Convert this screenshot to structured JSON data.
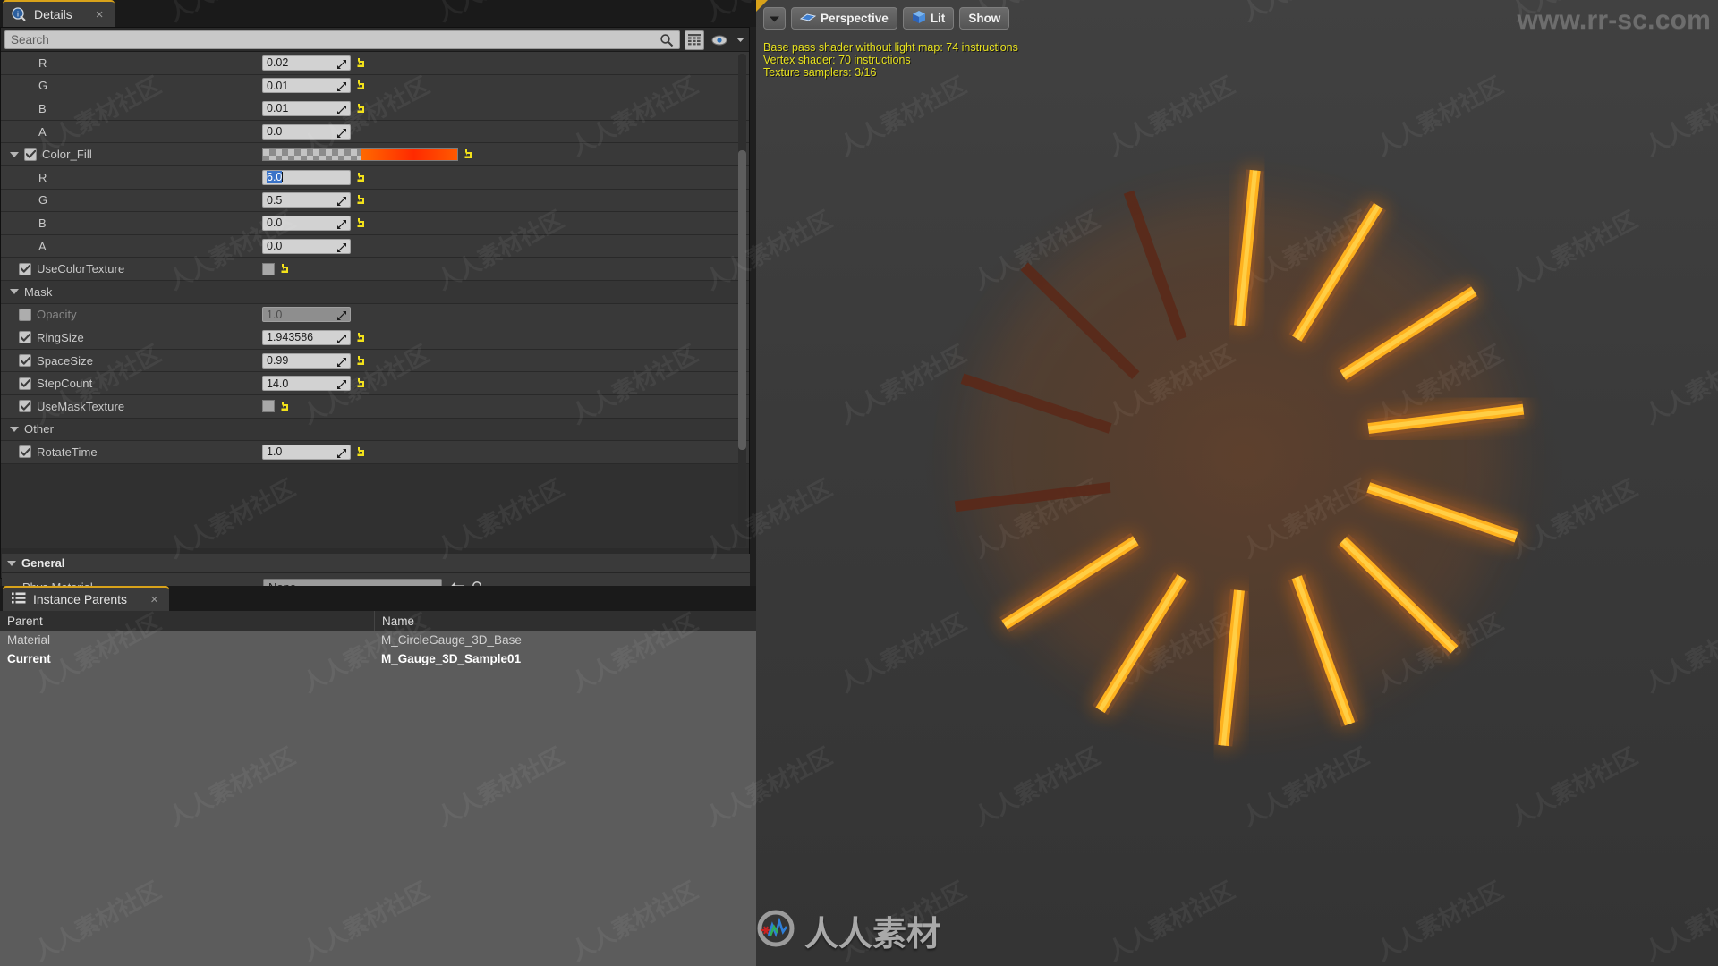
{
  "details_panel": {
    "tab_label": "Details",
    "tab_icon": "details-info-icon",
    "close_icon": "close-icon",
    "search": {
      "placeholder": "Search",
      "value": ""
    },
    "search_icon": "search-icon",
    "columns_icon": "columns-grid-icon",
    "visibility_icon": "eye-icon",
    "chevron_icon": "chevron-down-icon",
    "rows": [
      {
        "kind": "prop",
        "indent": 2,
        "check": null,
        "label": "R",
        "value": "0.02",
        "widget": "num",
        "revert": true
      },
      {
        "kind": "prop",
        "indent": 2,
        "check": null,
        "label": "G",
        "value": "0.01",
        "widget": "num",
        "revert": true
      },
      {
        "kind": "prop",
        "indent": 2,
        "check": null,
        "label": "B",
        "value": "0.01",
        "widget": "num",
        "revert": true
      },
      {
        "kind": "prop",
        "indent": 2,
        "check": null,
        "label": "A",
        "value": "0.0",
        "widget": "num",
        "revert": false
      },
      {
        "kind": "prop",
        "indent": 1,
        "check": true,
        "label": "Color_Fill",
        "value": "",
        "widget": "color",
        "revert": true,
        "expander": true
      },
      {
        "kind": "prop",
        "indent": 2,
        "check": null,
        "label": "R",
        "value": "6.0",
        "widget": "num",
        "revert": true,
        "editing": true
      },
      {
        "kind": "prop",
        "indent": 2,
        "check": null,
        "label": "G",
        "value": "0.5",
        "widget": "num",
        "revert": true
      },
      {
        "kind": "prop",
        "indent": 2,
        "check": null,
        "label": "B",
        "value": "0.0",
        "widget": "num",
        "revert": true
      },
      {
        "kind": "prop",
        "indent": 2,
        "check": null,
        "label": "A",
        "value": "0.0",
        "widget": "num",
        "revert": false
      },
      {
        "kind": "prop",
        "indent": 1,
        "check": true,
        "label": "UseColorTexture",
        "value": "",
        "widget": "bool",
        "revert": true
      },
      {
        "kind": "cat",
        "indent": 0,
        "check": null,
        "label": "Mask",
        "value": "",
        "widget": "none",
        "revert": false
      },
      {
        "kind": "prop",
        "indent": 1,
        "check": false,
        "label": "Opacity",
        "value": "1.0",
        "widget": "num-disabled",
        "revert": false,
        "dim": true
      },
      {
        "kind": "prop",
        "indent": 1,
        "check": true,
        "label": "RingSize",
        "value": "1.943586",
        "widget": "num",
        "revert": true
      },
      {
        "kind": "prop",
        "indent": 1,
        "check": true,
        "label": "SpaceSize",
        "value": "0.99",
        "widget": "num",
        "revert": true
      },
      {
        "kind": "prop",
        "indent": 1,
        "check": true,
        "label": "StepCount",
        "value": "14.0",
        "widget": "num",
        "revert": true
      },
      {
        "kind": "prop",
        "indent": 1,
        "check": true,
        "label": "UseMaskTexture",
        "value": "",
        "widget": "bool",
        "revert": true
      },
      {
        "kind": "cat",
        "indent": 0,
        "check": null,
        "label": "Other",
        "value": "",
        "widget": "none",
        "revert": false
      },
      {
        "kind": "prop",
        "indent": 1,
        "check": true,
        "label": "RotateTime",
        "value": "1.0",
        "widget": "num",
        "revert": true
      }
    ],
    "color_fill_swatch": "#ff6a00",
    "general": {
      "header": "General",
      "phys_material_label": "Phys Material",
      "phys_material_value": "None",
      "parent_label": "Parent",
      "parent_value": "M_CircleGauge_3D_Base",
      "back_arrow_icon": "back-arrow-icon",
      "browse_icon": "browse-magnifier-icon",
      "thumbnail_icon": "material-thumbnail"
    }
  },
  "instance_parents": {
    "tab_label": "Instance Parents",
    "tab_icon": "list-icon",
    "close_icon": "close-icon",
    "columns": [
      "Parent",
      "Name"
    ],
    "rows": [
      {
        "parent": "Material",
        "name": "M_CircleGauge_3D_Base",
        "current": false
      },
      {
        "parent": "Current",
        "name": "M_Gauge_3D_Sample01",
        "current": true
      }
    ]
  },
  "viewport": {
    "toolbar": {
      "menu_icon": "chevron-down-icon",
      "perspective_label": "Perspective",
      "perspective_icon": "camera-perspective-icon",
      "lit_label": "Lit",
      "lit_icon": "lit-cube-icon",
      "show_label": "Show"
    },
    "stats": [
      "Base pass shader without light map: 74 instructions",
      "Vertex shader: 70 instructions",
      "Texture samplers: 3/16"
    ],
    "stats_color": "#e8e21e",
    "gauge": {
      "step_count": 14,
      "lit_color": "#ffb21e",
      "lit_color_bright": "#ffd24a",
      "unlit_color": "#5a2a1a",
      "glow_color": "#ff7a12"
    }
  },
  "watermark": {
    "url": "www.rr-sc.com",
    "brand_cn": "人人素材",
    "tile_text": "人人素材社区",
    "logo_icon": "rr-logo-icon"
  }
}
